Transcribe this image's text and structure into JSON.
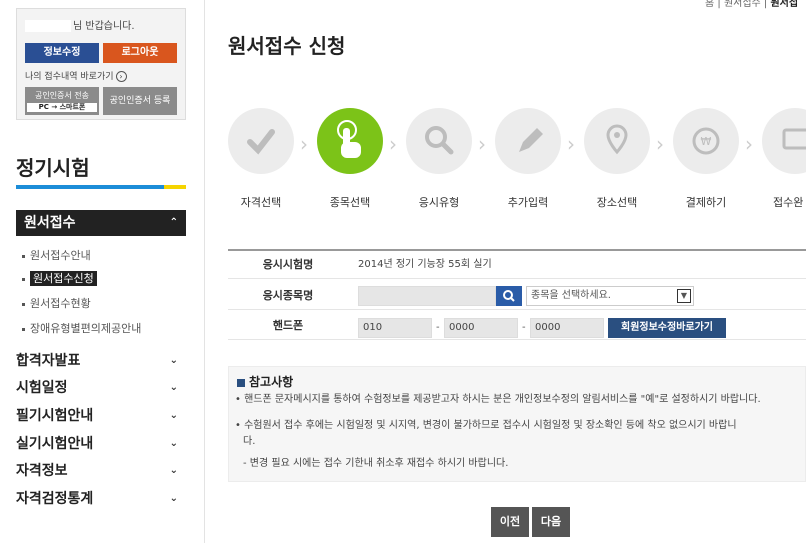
{
  "sidebar": {
    "greeting": "님 반갑습니다.",
    "edit_info": "정보수정",
    "logout": "로그아웃",
    "shortcut": "나의 접수내역 바로가기",
    "cert_transfer": "공인인증서 전송",
    "cert_transfer_sub": "PC → 스마트폰",
    "cert_register": "공인인증서 등록",
    "section_title": "정기시험",
    "active_menu": "원서접수",
    "sub_items": [
      "원서접수안내",
      "원서접수신청",
      "원서접수현황",
      "장애유형별편의제공안내"
    ],
    "menus": [
      "합격자발표",
      "시험일정",
      "필기시험안내",
      "실기시험안내",
      "자격정보",
      "자격검정통계"
    ]
  },
  "breadcrumb": {
    "home": "홈",
    "level1": "원서접수",
    "level2": "원서접"
  },
  "page_title": "원서접수 신청",
  "steps": [
    "자격선택",
    "종목선택",
    "응시유형",
    "추가입력",
    "장소선택",
    "결제하기",
    "접수완"
  ],
  "form": {
    "exam_name_label": "응시시험명",
    "exam_name_value": "2014년 정기 기능장 55회 실기",
    "subject_label": "응시종목명",
    "subject_placeholder": "종목을 선택하세요.",
    "phone_label": "핸드폰",
    "phone1": "010",
    "phone2": "0000",
    "phone3": "0000",
    "member_button": "회원정보수정바로가기"
  },
  "notice": {
    "title": "참고사항",
    "line1": "• 핸드폰 문자메시지를 통하여 수험정보를 제공받고자 하시는 분은 개인정보수정의 알림서비스를 \"예\"로 설정하시기 바랍니다.",
    "line2": "• 수험원서 접수 후에는 시험일정 및 시지역, 변경이 불가하므로 접수시 시험일정 및 장소확인 등에 착오 없으시기 바랍니",
    "line2b": "다.",
    "line3": "- 변경 필요 시에는 접수 기한내 취소후 재접수 하시기 바랍니다."
  },
  "buttons": {
    "prev": "이전",
    "next": "다음"
  },
  "colors": {
    "active_step": "#7cc318",
    "primary_blue": "#2a4f94",
    "logout_orange": "#d9561e"
  }
}
